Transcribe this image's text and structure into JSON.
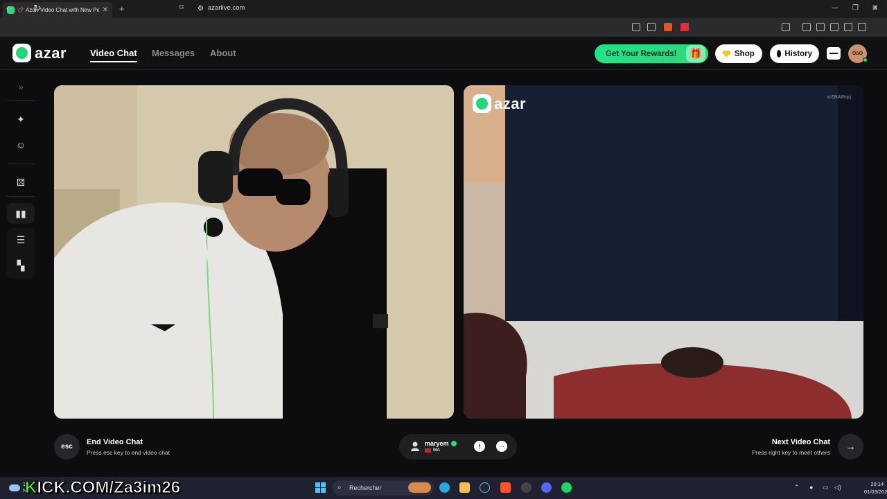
{
  "browser": {
    "tab_title": "Azar: Video Chat with New Pe",
    "url": "azarlive.com"
  },
  "site": {
    "logo_text": "azar",
    "nav": [
      "Video Chat",
      "Messages",
      "About"
    ],
    "rewards_label": "Get Your Rewards!",
    "shop_label": "Shop",
    "history_label": "History",
    "avatar_text": "O∆O"
  },
  "sidebar": {
    "icons": [
      "chevrons-right-icon",
      "magic-wand-icon",
      "face-filter-icon",
      "dice-icon",
      "layout-side-by-side-icon",
      "layout-stacked-icon",
      "layout-pip-icon"
    ]
  },
  "video": {
    "watermark_text": "azar",
    "watermark_id": "xc6BAtRqq"
  },
  "controls": {
    "end_key": "esc",
    "end_title": "End Video Chat",
    "end_subtitle": "Press esc key to end video chat",
    "partner_name": "maryem",
    "partner_country": "MA",
    "next_title": "Next Video Chat",
    "next_subtitle": "Press right key to meet others"
  },
  "taskbar": {
    "weather_temp": "18",
    "weather_label": "Nu",
    "overlay_text": "KICK.COM/Za3im26",
    "search_placeholder": "Rechercher",
    "time": "20:14",
    "date": "01/03/2026"
  }
}
